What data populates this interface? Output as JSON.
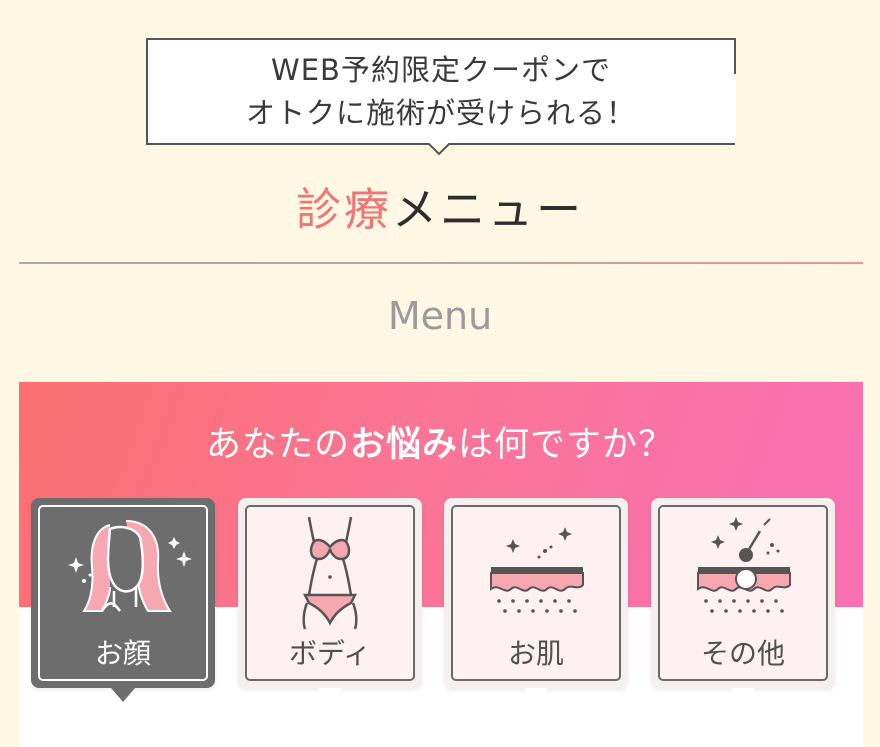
{
  "coupon": {
    "line1": "WEB予約限定クーポンで",
    "line2": "オトクに施術が受けられる！"
  },
  "heading": {
    "accent": "診療",
    "rest": "メニュー",
    "accent_color": "#f07575"
  },
  "subheading": "Menu",
  "question": {
    "before": "あなたの",
    "bold": "お悩み",
    "after": "は何ですか？"
  },
  "tabs": [
    {
      "label": "お顔",
      "icon": "face-icon",
      "active": true
    },
    {
      "label": "ボディ",
      "icon": "body-icon",
      "active": false
    },
    {
      "label": "お肌",
      "icon": "skin-icon",
      "active": false
    },
    {
      "label": "その他",
      "icon": "hair-removal-icon",
      "active": false
    }
  ],
  "colors": {
    "background": "#fdf7e4",
    "panel_gradient_start": "#fb6f6f",
    "panel_gradient_end": "#fb6fb6",
    "active_tab": "#6d6d6d"
  }
}
